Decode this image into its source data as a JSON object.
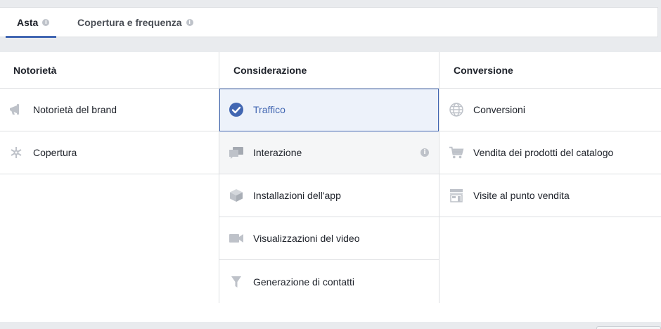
{
  "tabs": [
    {
      "label": "Asta",
      "active": true
    },
    {
      "label": "Copertura e frequenza",
      "active": false
    }
  ],
  "columns": [
    {
      "title": "Notorietà",
      "rows": [
        {
          "label": "Notorietà del brand",
          "icon": "megaphone-icon"
        },
        {
          "label": "Copertura",
          "icon": "reach-icon"
        }
      ]
    },
    {
      "title": "Considerazione",
      "rows": [
        {
          "label": "Traffico",
          "icon": "checkmark-circle-icon",
          "selected": true
        },
        {
          "label": "Interazione",
          "icon": "chat-bubbles-icon",
          "info": "i"
        },
        {
          "label": "Installazioni dell'app",
          "icon": "cube-icon"
        },
        {
          "label": "Visualizzazioni del video",
          "icon": "video-camera-icon"
        },
        {
          "label": "Generazione di contatti",
          "icon": "funnel-icon"
        }
      ]
    },
    {
      "title": "Conversione",
      "rows": [
        {
          "label": "Conversioni",
          "icon": "globe-icon"
        },
        {
          "label": "Vendita dei prodotti del catalogo",
          "icon": "shopping-cart-icon"
        },
        {
          "label": "Visite al punto vendita",
          "icon": "store-icon"
        }
      ]
    }
  ],
  "info_glyph": "i",
  "colors": {
    "accent": "#4267b2",
    "icon": "#bec2c9",
    "selected_bg": "#edf2fa"
  }
}
